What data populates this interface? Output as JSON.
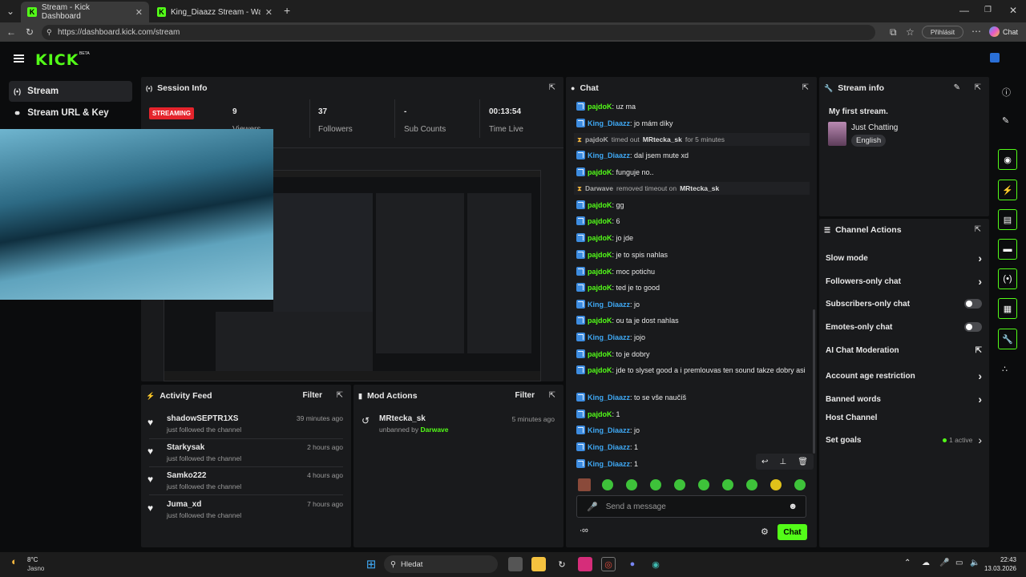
{
  "browser": {
    "tabs": [
      {
        "label": "Stream - Kick Dashboard",
        "active": true
      },
      {
        "label": "King_Diaazz Stream - Watch Live o",
        "active": false
      }
    ],
    "url": "https://dashboard.kick.com/stream",
    "profile_label": "Přihlásit",
    "copilot_label": "Chat"
  },
  "kick": {
    "logo": "KICK",
    "beta": "BETA"
  },
  "sidebar": {
    "items": [
      {
        "label": "Stream",
        "icon": "broadcast-icon"
      },
      {
        "label": "Stream URL & Key",
        "icon": "link-icon"
      }
    ]
  },
  "session": {
    "title": "Session Info",
    "status": "STREAMING",
    "stats": [
      {
        "value": "9",
        "label": "Viewers"
      },
      {
        "value": "37",
        "label": "Followers"
      },
      {
        "value": "-",
        "label": "Sub Counts"
      },
      {
        "value": "00:13:54",
        "label": "Time Live"
      }
    ]
  },
  "activity": {
    "title": "Activity Feed",
    "filter": "Filter",
    "items": [
      {
        "name": "shadowSEPTR1XS",
        "sub": "just followed the channel",
        "time": "39 minutes ago"
      },
      {
        "name": "Starkysak",
        "sub": "just followed the channel",
        "time": "2 hours ago"
      },
      {
        "name": "Samko222",
        "sub": "just followed the channel",
        "time": "4 hours ago"
      },
      {
        "name": "Juma_xd",
        "sub": "just followed the channel",
        "time": "7 hours ago"
      }
    ]
  },
  "mod": {
    "title": "Mod Actions",
    "filter": "Filter",
    "items": [
      {
        "name": "MRtecka_sk",
        "sub_prefix": "unbanned by",
        "by": "Darwave",
        "time": "5 minutes ago"
      }
    ]
  },
  "chat": {
    "title": "Chat",
    "messages": [
      {
        "type": "msg",
        "user": "pajdoK",
        "text": "uz ma",
        "color": "#53fc18"
      },
      {
        "type": "msg",
        "user": "King_Diaazz",
        "text": "jo mám díky",
        "color": "#3fa9f5"
      },
      {
        "type": "sys",
        "actor": "pajdoK",
        "action": "timed out",
        "target": "MRtecka_sk",
        "tail": "for 5 minutes"
      },
      {
        "type": "msg",
        "user": "King_Diaazz",
        "text": "dal jsem mute xd",
        "color": "#3fa9f5"
      },
      {
        "type": "msg",
        "user": "pajdoK",
        "text": "funguje no..",
        "color": "#53fc18"
      },
      {
        "type": "sys",
        "actor": "Darwave",
        "action": "removed timeout on",
        "target": "MRtecka_sk",
        "tail": ""
      },
      {
        "type": "msg",
        "user": "pajdoK",
        "text": "gg",
        "color": "#53fc18"
      },
      {
        "type": "msg",
        "user": "pajdoK",
        "text": "6",
        "color": "#53fc18"
      },
      {
        "type": "msg",
        "user": "pajdoK",
        "text": "jo jde",
        "color": "#53fc18"
      },
      {
        "type": "msg",
        "user": "pajdoK",
        "text": "je to spis nahlas",
        "color": "#53fc18"
      },
      {
        "type": "msg",
        "user": "pajdoK",
        "text": "moc potichu",
        "color": "#53fc18"
      },
      {
        "type": "msg",
        "user": "pajdoK",
        "text": "ted je to good",
        "color": "#53fc18"
      },
      {
        "type": "msg",
        "user": "King_Diaazz",
        "text": "jo",
        "color": "#3fa9f5"
      },
      {
        "type": "msg",
        "user": "pajdoK",
        "text": "ou ta je dost nahlas",
        "color": "#53fc18"
      },
      {
        "type": "msg",
        "user": "King_Diaazz",
        "text": "jojo",
        "color": "#3fa9f5"
      },
      {
        "type": "msg",
        "user": "pajdoK",
        "text": "to je dobry",
        "color": "#53fc18"
      },
      {
        "type": "msg",
        "user": "pajdoK",
        "text": "jde to slyset good a i premlouvas ten sound takze dobry asi",
        "color": "#53fc18"
      },
      {
        "type": "msg",
        "user": "King_Diaazz",
        "text": "to se vše naučíš",
        "color": "#3fa9f5"
      },
      {
        "type": "msg",
        "user": "pajdoK",
        "text": "1",
        "color": "#53fc18"
      },
      {
        "type": "msg",
        "user": "King_Diaazz",
        "text": "jo",
        "color": "#3fa9f5"
      },
      {
        "type": "msg",
        "user": "King_Diaazz",
        "text": "1",
        "color": "#3fa9f5"
      },
      {
        "type": "msg",
        "user": "King_Diaazz",
        "text": "1",
        "color": "#3fa9f5"
      }
    ],
    "placeholder": "Send a message",
    "send": "Chat"
  },
  "stream_info": {
    "title": "Stream info",
    "stream_title": "My first stream.",
    "category": "Just Chatting",
    "language": "English"
  },
  "channel_actions": {
    "title": "Channel Actions",
    "items": [
      {
        "label": "Slow mode",
        "control": "chevron"
      },
      {
        "label": "Followers-only chat",
        "control": "chevron"
      },
      {
        "label": "Subscribers-only chat",
        "control": "toggle"
      },
      {
        "label": "Emotes-only chat",
        "control": "toggle"
      },
      {
        "label": "AI Chat Moderation",
        "control": "external"
      },
      {
        "label": "Account age restriction",
        "control": "chevron"
      },
      {
        "label": "Banned words",
        "control": "chevron"
      },
      {
        "label": "Host Channel",
        "control": "none"
      },
      {
        "label": "Set goals",
        "control": "chevron",
        "extra": "1 active"
      }
    ]
  },
  "taskbar": {
    "weather_temp": "8°C",
    "weather_text": "Jasno",
    "search": "Hledat",
    "time": "22:43",
    "date": "13.03.2026"
  },
  "colors": {
    "accent": "#53fc18",
    "panel": "#191a1c",
    "streaming": "#e5242c",
    "kingblue": "#3fa9f5"
  }
}
